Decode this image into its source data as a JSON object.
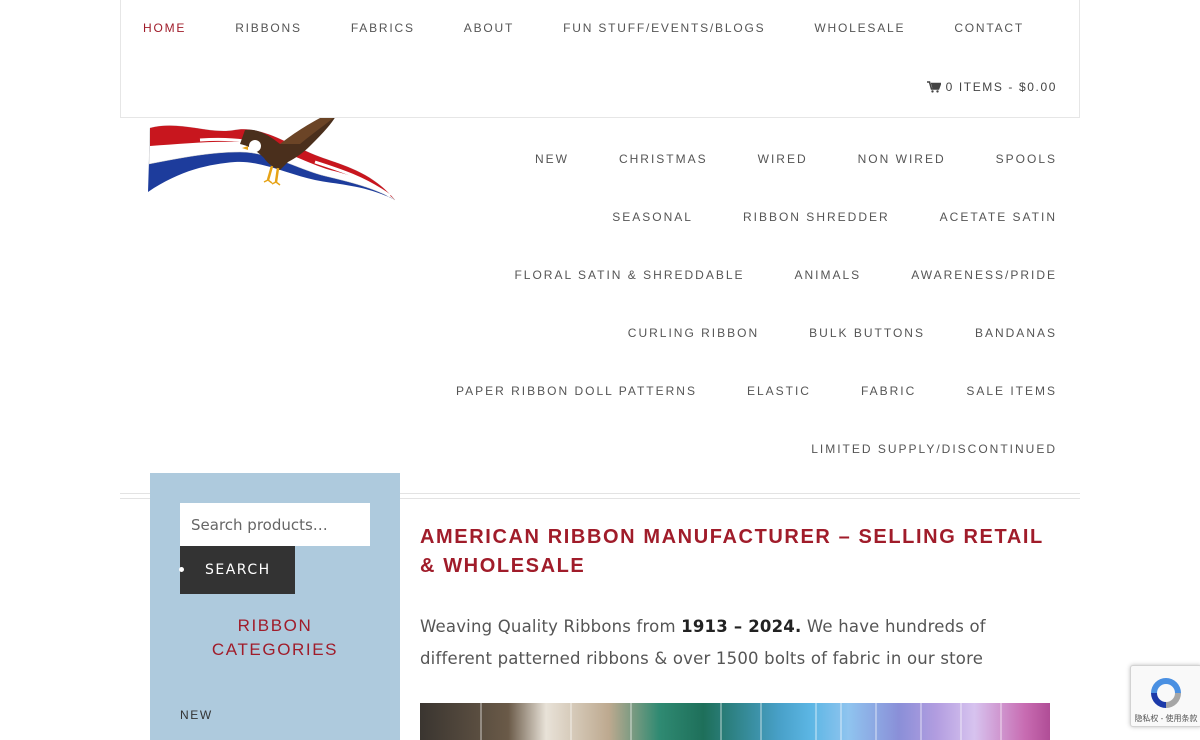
{
  "topnav": {
    "items": [
      {
        "label": "HOME",
        "active": true
      },
      {
        "label": "RIBBONS"
      },
      {
        "label": "FABRICS"
      },
      {
        "label": "ABOUT"
      },
      {
        "label": "FUN STUFF/EVENTS/BLOGS"
      },
      {
        "label": "WHOLESALE"
      },
      {
        "label": "CONTACT"
      }
    ],
    "cart_label": "0 ITEMS - $0.00",
    "cart_icon": "cart-icon"
  },
  "logo": {
    "icon": "eagle-flag-ribbon-logo"
  },
  "category_nav": {
    "rows": [
      [
        "NEW",
        "CHRISTMAS",
        "WIRED",
        "NON WIRED",
        "SPOOLS"
      ],
      [
        "SEASONAL",
        "RIBBON SHREDDER",
        "ACETATE SATIN"
      ],
      [
        "FLORAL SATIN & SHREDDABLE",
        "ANIMALS",
        "AWARENESS/PRIDE"
      ],
      [
        "CURLING RIBBON",
        "BULK BUTTONS",
        "BANDANAS"
      ],
      [
        "PAPER RIBBON DOLL PATTERNS",
        "ELASTIC",
        "FABRIC",
        "SALE ITEMS"
      ],
      [
        "LIMITED SUPPLY/DISCONTINUED"
      ]
    ]
  },
  "sidebar": {
    "search_placeholder": "Search products…",
    "search_button": "SEARCH",
    "heading_line1": "RIBBON",
    "heading_line2": "CATEGORIES",
    "first_category": "NEW"
  },
  "main": {
    "title": "AMERICAN RIBBON MANUFACTURER  – SELLING RETAIL & WHOLESALE",
    "text_before": "Weaving Quality Ribbons from ",
    "text_bold": "1913 – 2024.",
    "text_after": " We have hundreds of different patterned ribbons & over 1500 bolts of fabric in our store"
  },
  "recaptcha": {
    "text": "隐私权 - 使用条款",
    "icon": "recaptcha-icon"
  },
  "colors": {
    "accent": "#a01c2a",
    "sidebar_bg": "#aecadd",
    "button_bg": "#333333"
  }
}
